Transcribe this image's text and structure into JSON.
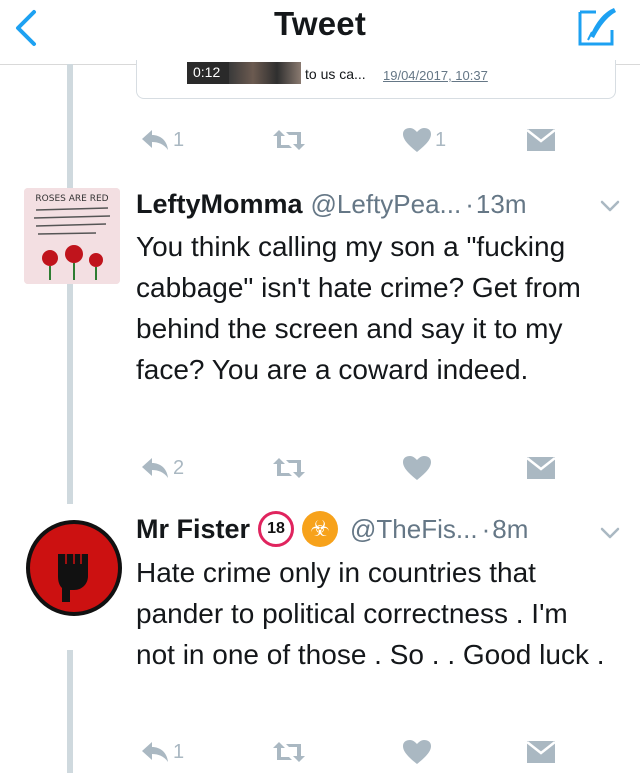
{
  "nav": {
    "title": "Tweet"
  },
  "media_card": {
    "video_duration": "0:12",
    "text": "to us ca...",
    "date": "19/04/2017, 10:37"
  },
  "tweets": [
    {
      "actions": {
        "reply_count": "1",
        "retweet_count": "",
        "like_count": "1"
      }
    },
    {
      "name": "LeftyMomma",
      "handle": "@LeftyPea...",
      "separator": "·",
      "time": "13m",
      "avatar_text": "ROSES ARE RED",
      "text": "You think calling my son a \"fucking cabbage\" isn't hate crime? Get from behind the screen and say it to my face? You are a coward indeed.",
      "actions": {
        "reply_count": "2",
        "retweet_count": "",
        "like_count": ""
      }
    },
    {
      "name": "Mr Fister",
      "badge1": "18",
      "badge2": "☣",
      "handle": "@TheFis...",
      "separator": "·",
      "time": "8m",
      "text": "Hate crime only in countries that pander to political correctness . I'm not in one of those . So . . Good luck .",
      "actions": {
        "reply_count": "1",
        "retweet_count": "",
        "like_count": ""
      }
    }
  ],
  "colors": {
    "accent": "#1da1f2",
    "action_gray": "#aab8c2",
    "secondary": "#657786"
  }
}
